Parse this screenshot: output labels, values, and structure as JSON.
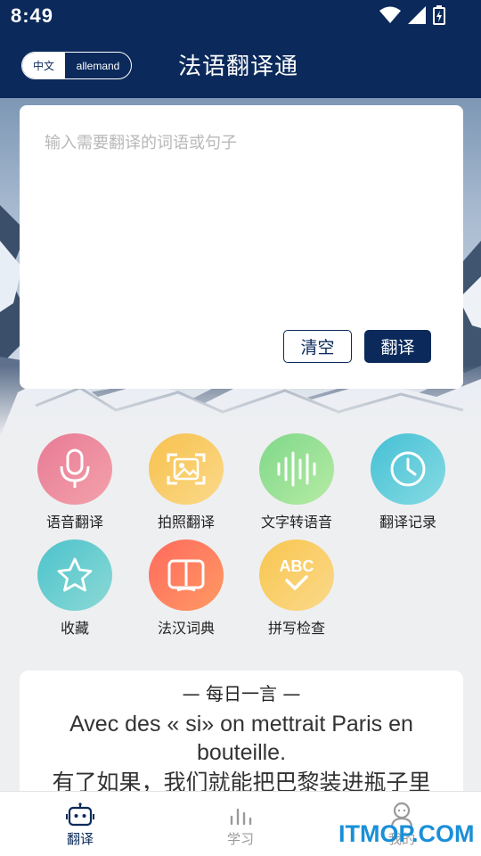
{
  "status_bar": {
    "time": "8:49"
  },
  "header": {
    "title": "法语翻译通",
    "lang_toggle": {
      "left": "中文",
      "right": "allemand"
    }
  },
  "input": {
    "placeholder": "输入需要翻译的词语或句子",
    "value": "",
    "clear_label": "清空",
    "translate_label": "翻译"
  },
  "features": [
    {
      "label": "语音翻译",
      "icon": "microphone-icon",
      "color_from": "#e87a95",
      "color_to": "#f3a2ab"
    },
    {
      "label": "拍照翻译",
      "icon": "photo-scan-icon",
      "color_from": "#f7c14d",
      "color_to": "#fbd98a"
    },
    {
      "label": "文字转语音",
      "icon": "sound-wave-icon",
      "color_from": "#7fd88a",
      "color_to": "#b6eba4"
    },
    {
      "label": "翻译记录",
      "icon": "clock-icon",
      "color_from": "#45c0d5",
      "color_to": "#86dbe2"
    },
    {
      "label": "收藏",
      "icon": "star-icon",
      "color_from": "#4cc3cd",
      "color_to": "#8cd9d4"
    },
    {
      "label": "法汉词典",
      "icon": "book-icon",
      "color_from": "#ff6a5e",
      "color_to": "#ff9a63"
    },
    {
      "label": "拼写检查",
      "icon": "abc-check-icon",
      "color_from": "#f8c64f",
      "color_to": "#fbd98b"
    }
  ],
  "daily_quote": {
    "title": "—  每日一言  —",
    "french": "Avec des « si» on mettrait Paris en bouteille.",
    "chinese": "有了如果，我们就能把巴黎装进瓶子里"
  },
  "bottom_nav": [
    {
      "label": "翻译",
      "icon": "robot-icon",
      "active": true
    },
    {
      "label": "学习",
      "icon": "bar-chart-icon",
      "active": false
    },
    {
      "label": "我的",
      "icon": "user-icon",
      "active": false
    }
  ],
  "watermark": "ITMOP.COM",
  "colors": {
    "brand": "#0b2a5b",
    "background": "#eeeff1",
    "active_nav": "#0b2a5b",
    "inactive_nav": "#9a9a9a",
    "watermark": "#1a8fd8"
  }
}
